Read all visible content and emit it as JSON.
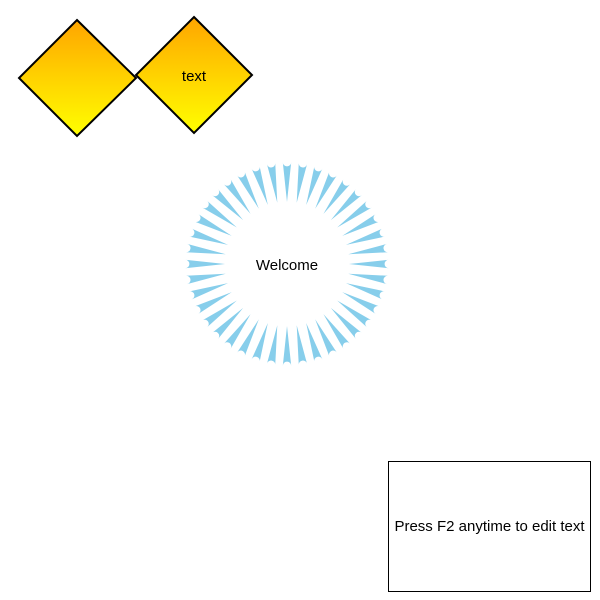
{
  "shapes": {
    "diamond_left": {
      "text": ""
    },
    "diamond_right": {
      "text": "text"
    },
    "starburst": {
      "text": "Welcome",
      "petal_count": 40
    },
    "text_box": {
      "text": "Press F2 anytime to edit text"
    }
  },
  "colors": {
    "diamond_gradient_top": "#FFA500",
    "diamond_gradient_bottom": "#FFFF00",
    "diamond_stroke": "#000000",
    "starburst_fill": "#87CEEB",
    "background": "#FFFFFF"
  }
}
